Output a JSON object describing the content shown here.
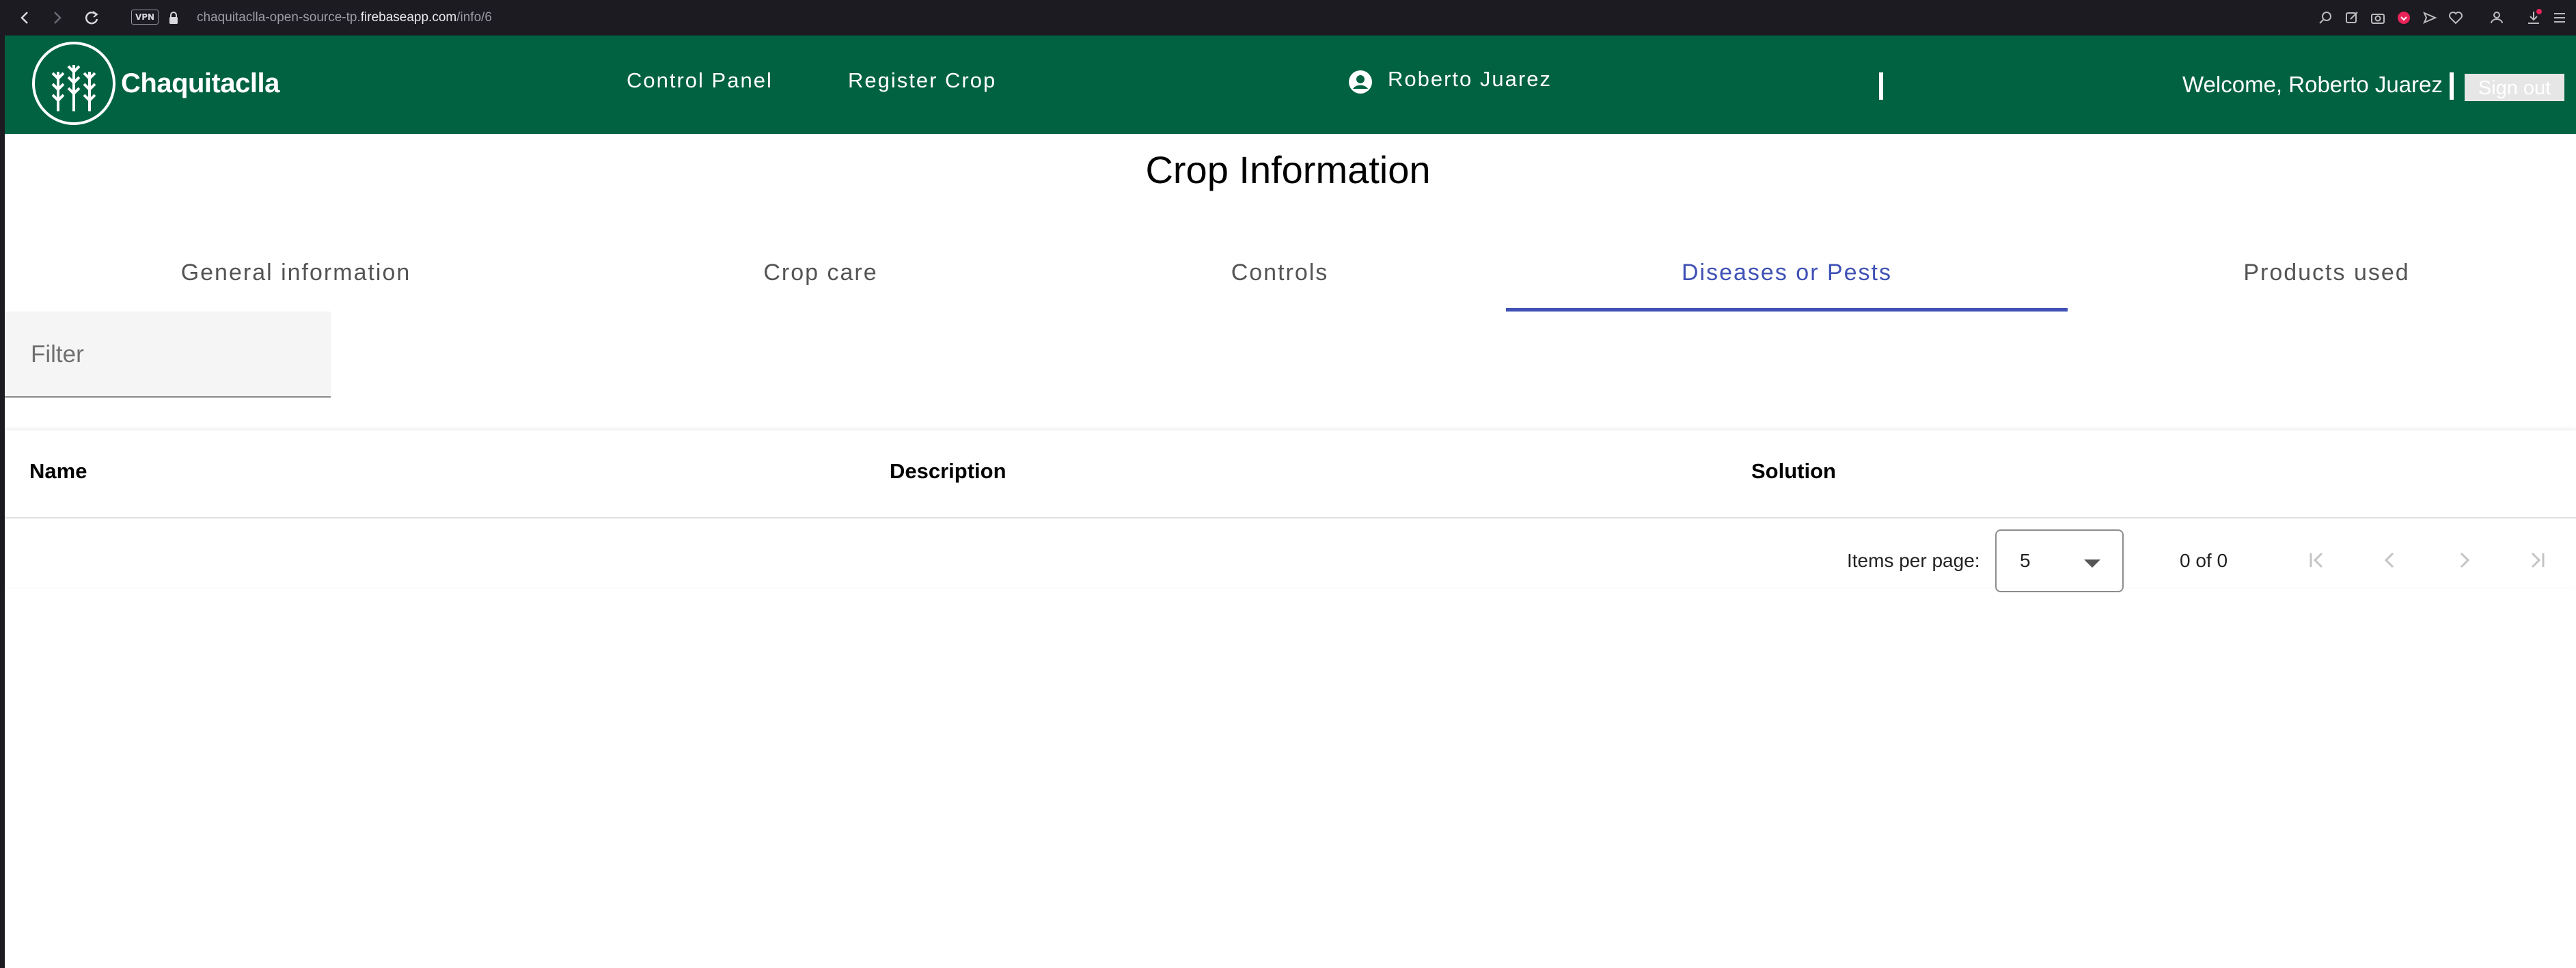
{
  "browser": {
    "url_prefix": "chaquitaclla-open-source-tp.",
    "url_domain": "firebaseapp.com",
    "url_path": "/info/6",
    "vpn_label": "VPN"
  },
  "header": {
    "brand": "Chaquitaclla",
    "nav": [
      "Control Panel",
      "Register Crop"
    ],
    "user_name": "Roberto Juarez",
    "welcome": "Welcome, Roberto Juarez",
    "sign_out": "Sign out",
    "bg_color": "#006241"
  },
  "page": {
    "title": "Crop Information",
    "tabs": [
      {
        "label": "General information",
        "active": false
      },
      {
        "label": "Crop care",
        "active": false
      },
      {
        "label": "Controls",
        "active": false
      },
      {
        "label": "Diseases or Pests",
        "active": true
      },
      {
        "label": "Products used",
        "active": false
      }
    ],
    "accent_color": "#3f51b5"
  },
  "filter": {
    "placeholder": "Filter",
    "value": ""
  },
  "table": {
    "columns": [
      "Name",
      "Description",
      "Solution"
    ],
    "rows": []
  },
  "paginator": {
    "items_per_page_label": "Items per page:",
    "page_size": "5",
    "range": "0 of 0"
  }
}
